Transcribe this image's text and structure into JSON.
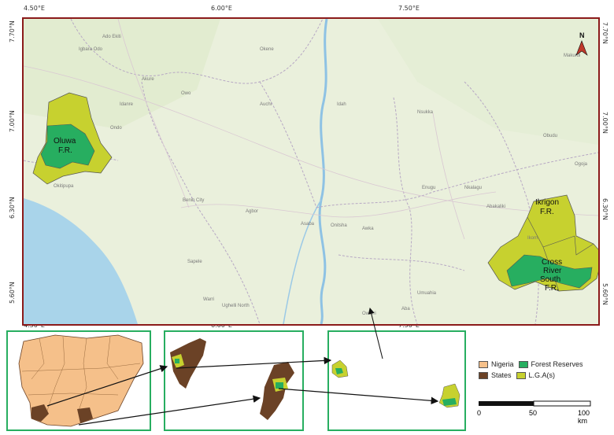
{
  "map": {
    "lon_labels": [
      "4.50°E",
      "6.00°E",
      "7.50°E"
    ],
    "lat_labels": [
      "7.70°N",
      "7.00°N",
      "6.30°N",
      "5.60°N"
    ],
    "north_label": "N",
    "forest_reserves": {
      "oluwa": [
        "Oluwa",
        "F.R."
      ],
      "ikrigon": [
        "Ikrigon",
        "F.R."
      ],
      "cross_river": [
        "Cross",
        "River",
        "South",
        "F.R."
      ]
    },
    "places": [
      "Ado Ekiti",
      "Igbara Odo",
      "Akure",
      "Owo",
      "Idanre",
      "Ondo",
      "Benin City",
      "Auchi",
      "Okene",
      "Idah",
      "Nsukka",
      "Enugu",
      "Onitsha",
      "Asaba",
      "Agbor",
      "Sapele",
      "Warri",
      "Ughelli North",
      "Owerri",
      "Umuahia",
      "Aba",
      "Abakaliki",
      "Ogoja",
      "Ikom",
      "Okitipupa",
      "Obudu",
      "Makurdi",
      "Awka",
      "Nkalagu"
    ]
  },
  "legend": {
    "items": [
      {
        "label": "Nigeria",
        "color": "#f5c08a"
      },
      {
        "label": "Forest Reserves",
        "color": "#27ae60"
      },
      {
        "label": "States",
        "color": "#6b4226"
      },
      {
        "label": "L.G.A(s)",
        "color": "#c7d12f"
      }
    ]
  },
  "scale": {
    "ticks": [
      "0",
      "50",
      "100 km"
    ]
  },
  "colors": {
    "frame": "#8b1a1a",
    "inset_border": "#27ae60",
    "lga": "#c7d12f",
    "forest": "#27ae60",
    "sea": "#a9d4ea",
    "river": "#9bc9e6",
    "nigeria": "#f5c08a",
    "states": "#6b4226"
  }
}
